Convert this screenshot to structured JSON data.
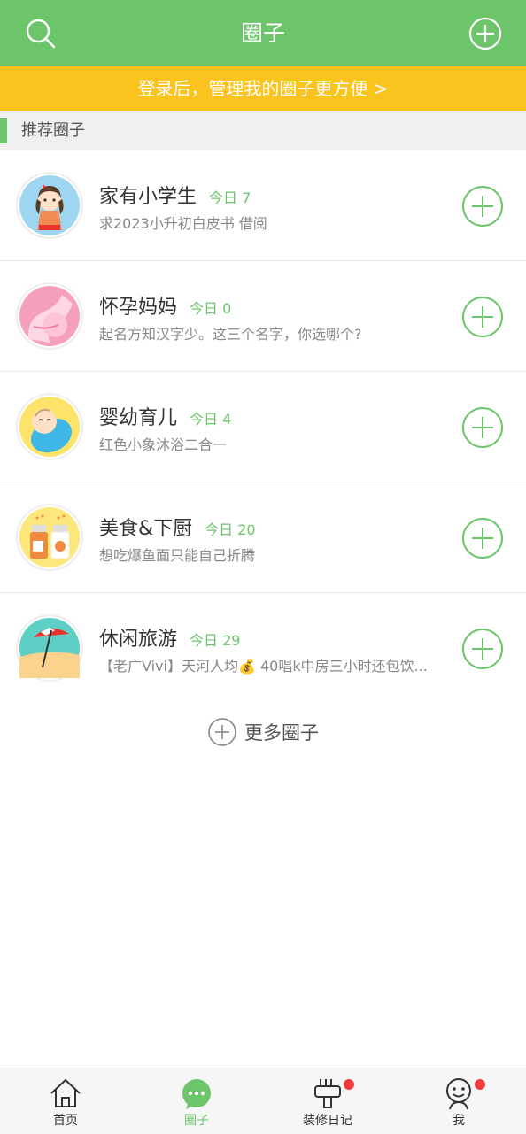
{
  "header": {
    "title": "圈子",
    "search_icon": "search-icon",
    "add_icon": "plus-circle-icon"
  },
  "banner": {
    "text": "登录后，管理我的圈子更方便 >"
  },
  "section": {
    "title": "推荐圈子"
  },
  "circles": [
    {
      "name": "家有小学生",
      "today": "今日 7",
      "desc": "求2023小升初白皮书 借阅",
      "icon": "schoolgirl-avatar"
    },
    {
      "name": "怀孕妈妈",
      "today": "今日 0",
      "desc": "起名方知汉字少。这三个名字，你选哪个?",
      "icon": "pregnant-avatar"
    },
    {
      "name": "婴幼育儿",
      "today": "今日 4",
      "desc": "红色小象沐浴二合一",
      "icon": "baby-avatar"
    },
    {
      "name": "美食&下厨",
      "today": "今日 20",
      "desc": "想吃爆鱼面只能自己折腾",
      "icon": "seasoning-bottles-avatar"
    },
    {
      "name": "休闲旅游",
      "today": "今日 29",
      "desc": "【老广Vivi】天河人均💰 40唱k中房三小时还包饮...",
      "icon": "beach-umbrella-avatar"
    }
  ],
  "more": {
    "label": "更多圈子"
  },
  "tabbar": {
    "items": [
      {
        "label": "首页",
        "icon": "home-icon"
      },
      {
        "label": "圈子",
        "icon": "chat-bubble-icon",
        "active": true
      },
      {
        "label": "装修日记",
        "icon": "paint-brush-icon",
        "badge": true
      },
      {
        "label": "我",
        "icon": "user-face-icon",
        "badge": true
      }
    ]
  },
  "colors": {
    "primary": "#6cc56a",
    "banner": "#fbc31d",
    "badge": "#ef3b3b"
  }
}
